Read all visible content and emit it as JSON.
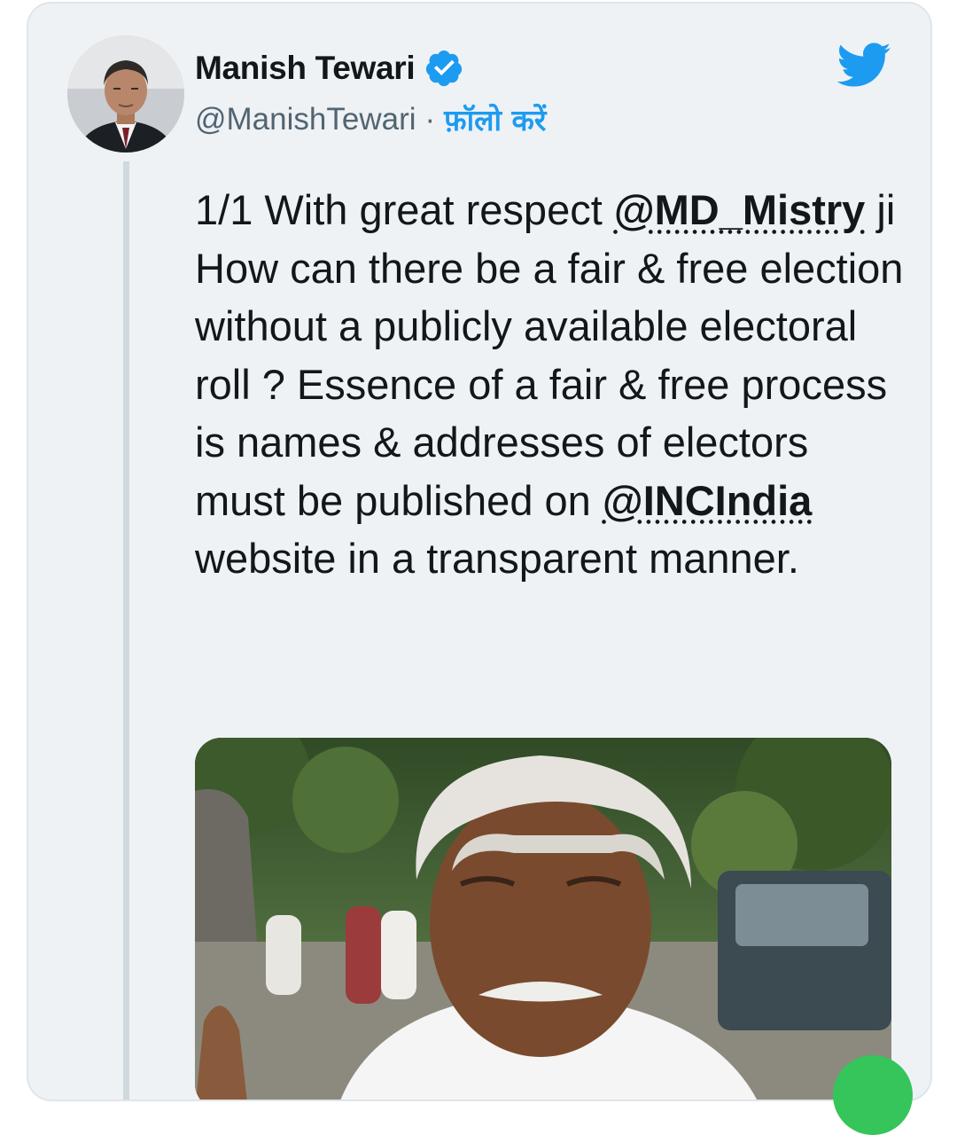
{
  "tweet": {
    "author": {
      "display_name": "Manish Tewari",
      "handle": "@ManishTewari",
      "separator": "·",
      "follow_label": "फ़ॉलो करें",
      "verified_icon": "verified-badge-icon",
      "avatar_icon": "profile-photo"
    },
    "brand_icon": "twitter-bird-icon",
    "text": {
      "part1": "1/1 With great respect ",
      "mention1": "@MD_Mistry",
      "part2": " ji How can there be a fair & free election without a publicly available electoral roll ? Essence  of a fair & free process is names & addresses of electors must be published on ",
      "mention2": "@INCIndia",
      "part3": " website in a transparent manner."
    },
    "media": {
      "description_icon": "photo-attachment"
    }
  },
  "colors": {
    "card_background": "#eef2f5",
    "card_border": "#dfe5ea",
    "twitter_blue": "#1d9bf0",
    "text_primary": "#14171a",
    "text_secondary": "#536471",
    "thread_line": "#cfd9de"
  }
}
